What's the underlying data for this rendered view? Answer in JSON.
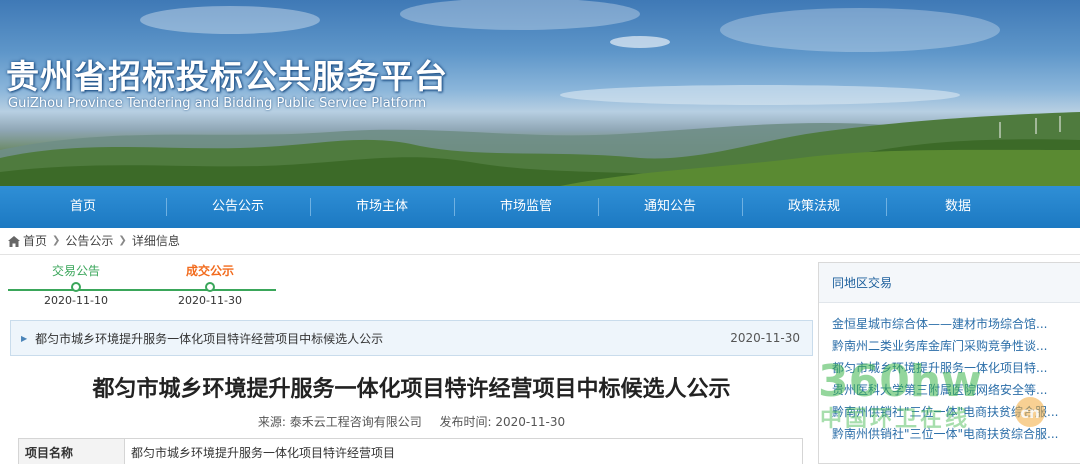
{
  "header": {
    "title": "贵州省招标投标公共服务平台",
    "subtitle": "GuiZhou Province Tendering and Bidding Public Service Platform"
  },
  "nav": {
    "items": [
      "首页",
      "公告公示",
      "市场主体",
      "市场监管",
      "通知公告",
      "政策法规",
      "数据"
    ]
  },
  "breadcrumb": {
    "home": "首页",
    "level1": "公告公示",
    "level2": "详细信息"
  },
  "timeline": {
    "steps": [
      {
        "label": "交易公告",
        "date": "2020-11-10"
      },
      {
        "label": "成交公示",
        "date": "2020-11-30"
      }
    ]
  },
  "notice": {
    "title": "都匀市城乡环境提升服务一体化项目特许经营项目中标候选人公示",
    "date": "2020-11-30"
  },
  "article": {
    "title": "都匀市城乡环境提升服务一体化项目特许经营项目中标候选人公示",
    "source": "来源: 泰禾云工程咨询有限公司",
    "publish_time": "发布时间: 2020-11-30",
    "table": [
      {
        "key": "项目名称",
        "value": "都匀市城乡环境提升服务一体化项目特许经营项目"
      }
    ]
  },
  "sidebar": {
    "heading": "同地区交易",
    "items": [
      "金恒星城市综合体——建材市场综合馆...",
      "黔南州二类业务库金库门采购竞争性谈...",
      "都匀市城乡环境提升服务一体化项目特...",
      "贵州医科大学第三附属医院网络安全等...",
      "黔南州供销社\"三位一体\"电商扶贫综合服...",
      "黔南州供销社\"三位一体\"电商扶贫综合服..."
    ]
  },
  "watermark": {
    "text_main": "360hw",
    "text_sub": "中国环卫在线",
    "logo_text": "cn"
  },
  "colors": {
    "nav_bg": "#1c79c2",
    "timeline_green": "#3aa65a",
    "timeline_orange": "#f26b1d",
    "link_blue": "#2b6ea8"
  }
}
